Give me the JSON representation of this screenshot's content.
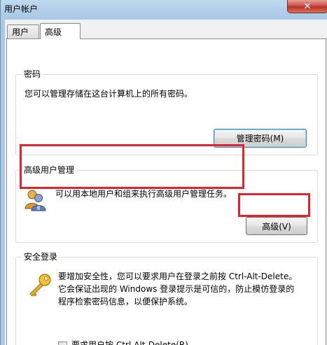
{
  "window": {
    "title": "用户帐户"
  },
  "tabs": [
    {
      "label": "用户"
    },
    {
      "label": "高级"
    }
  ],
  "password": {
    "title": "密码",
    "description": "您可以管理存储在这台计算机上的所有密码。",
    "button": "管理密码(M)"
  },
  "advanced_user": {
    "title": "高级用户管理",
    "description": "可以用本地用户和组来执行高级用户管理任务。",
    "button": "高级(V)",
    "icon": "users-icon"
  },
  "secure_login": {
    "title": "安全登录",
    "line1": "要增加安全性，您可以要求用户在登录之前按 Ctrl-Alt-Delete。",
    "line2": "它会保证出现的 Windows 登录提示是可信的，防止模仿登录的",
    "line3": "程序检索密码信息，以便保护系统。",
    "checkbox_label": "要求用户按 Ctrl-Alt-Delete(R)",
    "checkbox_checked": false,
    "icon": "key-icon"
  },
  "colors": {
    "highlight": "#e0242b",
    "title_bar": "#a9c9e6"
  }
}
